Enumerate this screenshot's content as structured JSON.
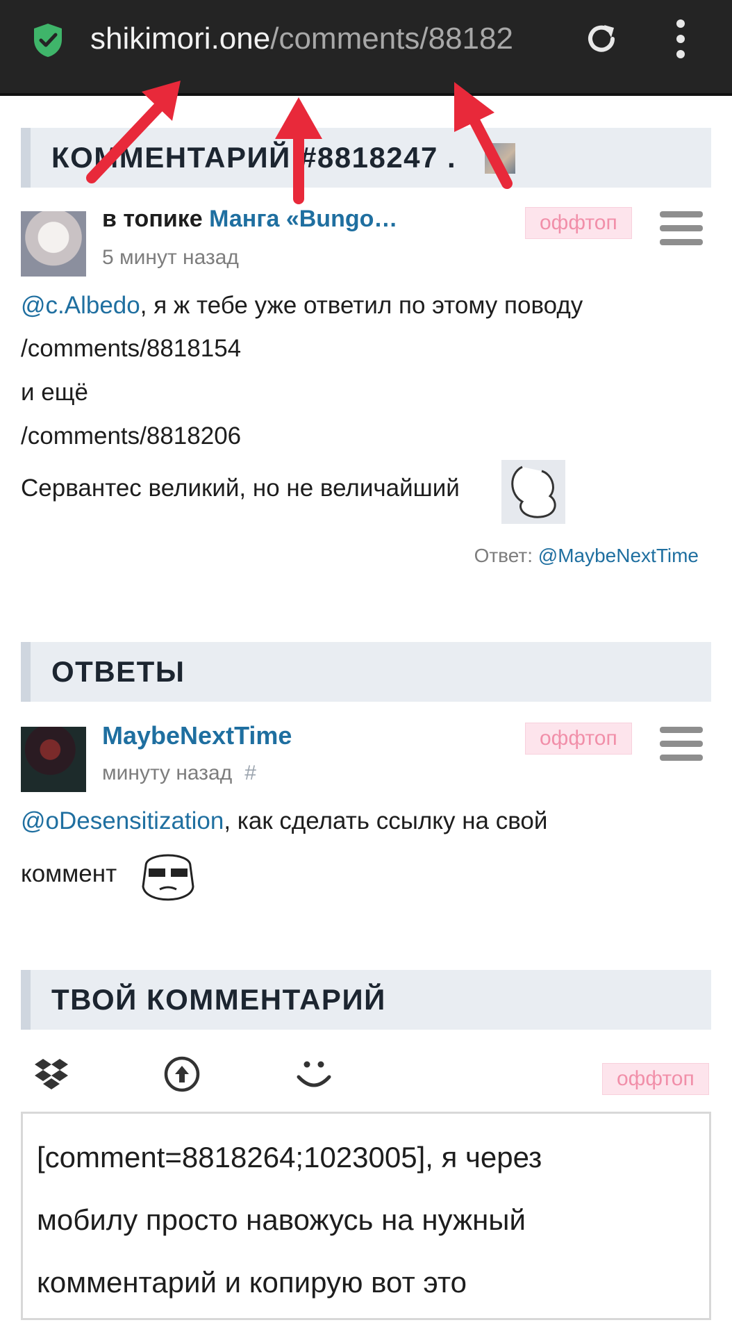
{
  "browser": {
    "url_host": "shikimori.one",
    "url_path": "/comments/88182",
    "accent": "#3fb56a"
  },
  "comment_section": {
    "title": "КОММЕНТАРИЙ #8818247 ."
  },
  "comment": {
    "topic_prefix": "в топике",
    "topic_link": "Манга «Bungo…",
    "time": "5 минут назад",
    "badge": "оффтоп",
    "mention": "@c.Albedo",
    "line1_rest": ", я ж тебе уже ответил по этому поводу",
    "link1": "/comments/8818154",
    "line3": "и ещё",
    "link2": "/comments/8818206",
    "line5": "Сервантес великий, но не величайший",
    "reply_label": "Ответ:",
    "reply_user": "@MaybeNextTime"
  },
  "replies_section": {
    "title": "ОТВЕТЫ"
  },
  "reply": {
    "author": "MaybeNextTime",
    "time": "минуту назад",
    "hash": "#",
    "badge": "оффтоп",
    "mention": "@oDesensitization",
    "line1_rest": ", как сделать ссылку на свой",
    "line2": "коммент"
  },
  "editor_section": {
    "title": "ТВОЙ КОММЕНТАРИЙ",
    "badge": "оффтоп",
    "tools": [
      "dropbox-icon",
      "upload-icon",
      "smiley-icon"
    ],
    "text": "[comment=8818264;1023005], я через\nмобилу просто навожусь на нужный\nкомментарий и копирую вот это"
  },
  "colors": {
    "link": "#1f6fa0",
    "badge_bg": "#fde4ec",
    "badge_text": "#f18fa9",
    "header_bg": "#e9edf2",
    "arrow": "#e8293a"
  }
}
